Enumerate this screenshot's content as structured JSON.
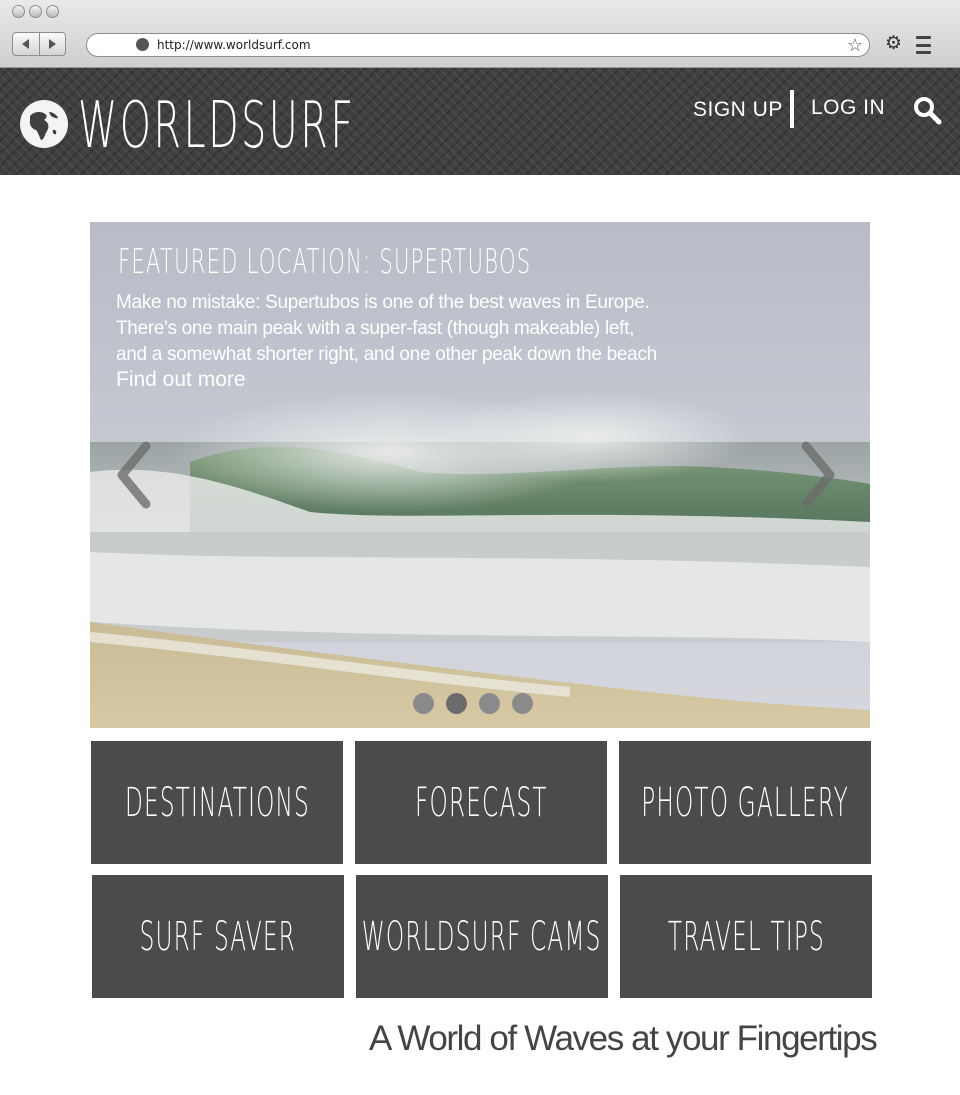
{
  "browser": {
    "url": "http://www.worldsurf.com",
    "icons": [
      "back-icon",
      "forward-icon",
      "globe-icon",
      "star-icon",
      "gear-icon",
      "menu-icon"
    ]
  },
  "header": {
    "logo_text": "WORLDSURF",
    "signup_label": "SIGN UP",
    "login_label": "LOG IN",
    "icons": [
      "globe-logo-icon",
      "search-icon"
    ],
    "colors": {
      "header_bg": "#3f3f3f"
    }
  },
  "hero": {
    "title": "FEATURED LOCATION: SUPERTUBOS",
    "description_lines": [
      "Make no mistake: Supertubos is one of the best waves in Europe.",
      "There's one main peak with a super-fast (though makeable) left,",
      "and a somewhat shorter right, and one other peak down the beach"
    ],
    "link": "Find out more",
    "slide_count": 4,
    "active_slide": 2,
    "icons": [
      "chevron-left-icon",
      "chevron-right-icon"
    ]
  },
  "tiles": [
    "DESTINATIONS",
    "FORECAST",
    "PHOTO GALLERY",
    "SURF SAVER",
    "WORLDSURF CAMS",
    "TRAVEL TIPS"
  ],
  "tagline": "A World of Waves at your Fingertips",
  "colors": {
    "tile_bg": "#4b4b4b",
    "page_bg": "#ffffff"
  }
}
